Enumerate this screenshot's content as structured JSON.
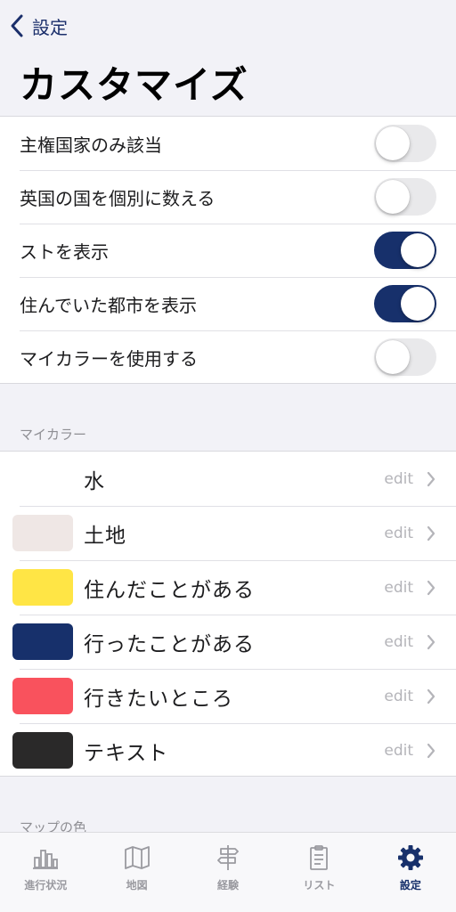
{
  "nav": {
    "back_label": "設定"
  },
  "page": {
    "title": "カスタマイズ"
  },
  "toggles": [
    {
      "label": "主権国家のみ該当",
      "on": false
    },
    {
      "label": "英国の国を個別に数える",
      "on": false
    },
    {
      "label": "ストを表示",
      "on": true
    },
    {
      "label": "住んでいた都市を表示",
      "on": true
    },
    {
      "label": "マイカラーを使用する",
      "on": false
    }
  ],
  "my_color_section": {
    "header": "マイカラー",
    "edit_label": "edit",
    "items": [
      {
        "label": "水",
        "color": "#ffffff"
      },
      {
        "label": "土地",
        "color": "#efe7e5"
      },
      {
        "label": "住んだことがある",
        "color": "#ffe545"
      },
      {
        "label": "行ったことがある",
        "color": "#17306b"
      },
      {
        "label": "行きたいところ",
        "color": "#f9525d"
      },
      {
        "label": "テキスト",
        "color": "#2a2929"
      }
    ]
  },
  "map_color_section": {
    "header": "マップの色"
  },
  "tabbar": {
    "tabs": [
      {
        "label": "進行状況",
        "icon": "bar-chart-icon",
        "active": false
      },
      {
        "label": "地図",
        "icon": "map-icon",
        "active": false
      },
      {
        "label": "経験",
        "icon": "signpost-icon",
        "active": false
      },
      {
        "label": "リスト",
        "icon": "clipboard-icon",
        "active": false
      },
      {
        "label": "設定",
        "icon": "gear-icon",
        "active": true
      }
    ]
  },
  "colors": {
    "accent": "#17306b",
    "switch_off": "#e9e9eb",
    "background": "#f2f2f7"
  }
}
